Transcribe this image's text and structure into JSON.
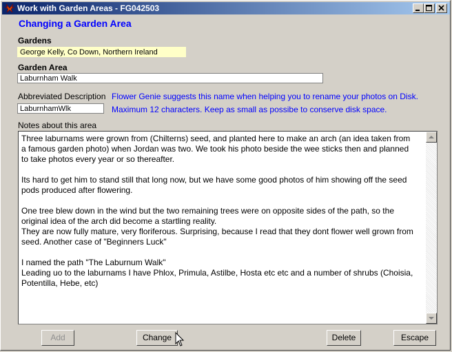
{
  "window": {
    "title": "Work with Garden Areas - FG042503",
    "heading": "Changing a Garden Area"
  },
  "gardens": {
    "label": "Gardens",
    "value": "George Kelly, Co Down, Northern Ireland"
  },
  "garden_area": {
    "label": "Garden Area",
    "value": "Laburnham Walk"
  },
  "abbreviated": {
    "label": "Abbreviated Description",
    "value": "LaburnhamWlk",
    "hint1": "Flower Genie suggests this name when helping you to rename your photos on Disk.",
    "hint2": "Maximum 12 characters. Keep as small as possibe to conserve disk space."
  },
  "notes": {
    "label": "Notes about this area",
    "text": "Three laburnams were grown from (Chilterns) seed, and planted here to make an arch (an idea taken from\na famous garden photo) when Jordan was two. We took his photo beside the wee sticks then and planned\nto take photos every year or so thereafter.\n\nIts hard to get him to stand still that long now, but we have some good photos of him showing off the seed\npods produced after flowering.\n\nOne tree blew down in the wind but the two remaining trees were on opposite sides of the path, so the\noriginal idea of the arch did become a startling reality.\nThey are now fully mature, very floriferous. Surprising, because I read that they dont flower well grown from\nseed. Another case of \"Beginners Luck\"\n\nI named the path \"The Laburnum Walk\"\nLeading uo to the laburnams I have Phlox, Primula, Astilbe, Hosta etc etc and a number of shrubs (Choisia,\nPotentilla, Hebe, etc)"
  },
  "buttons": {
    "add": "Add",
    "change": "Change",
    "delete": "Delete",
    "escape": "Escape"
  },
  "colors": {
    "accent": "#0000ff",
    "title_start": "#0a246a",
    "title_end": "#a6caf0",
    "gardens_bg": "#ffffc8"
  }
}
